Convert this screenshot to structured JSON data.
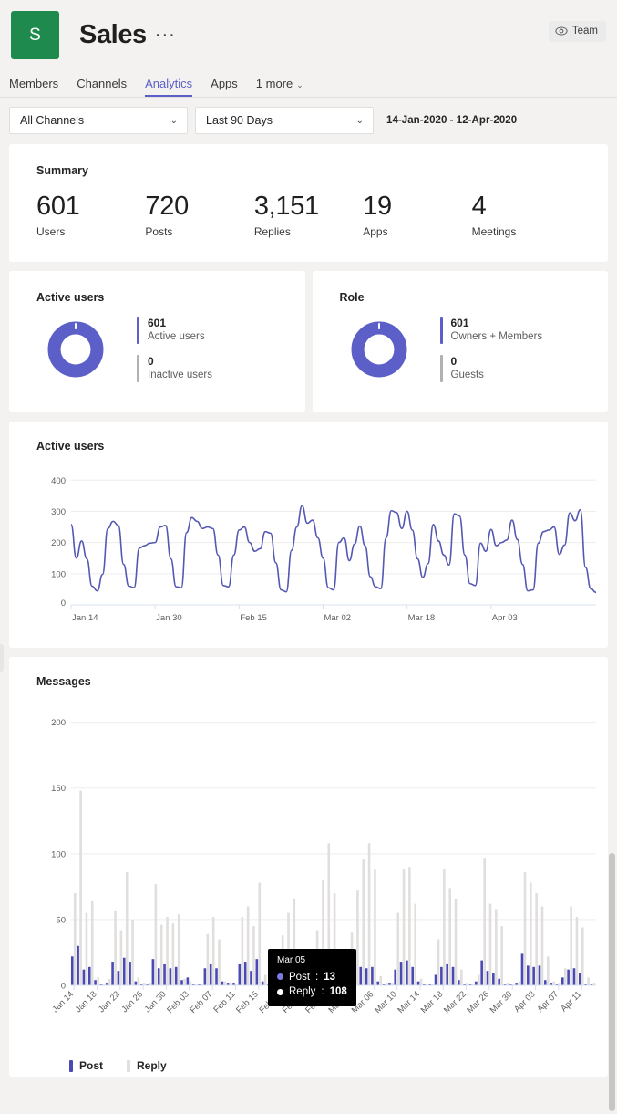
{
  "header": {
    "avatar_initial": "S",
    "team_name": "Sales",
    "more_options": "···",
    "badge_label": "Team",
    "badge_icon": "eye-icon"
  },
  "tabs": [
    {
      "label": "Members",
      "active": false
    },
    {
      "label": "Channels",
      "active": false
    },
    {
      "label": "Analytics",
      "active": true
    },
    {
      "label": "Apps",
      "active": false
    },
    {
      "label": "1 more",
      "active": false,
      "chevron": "⌄"
    }
  ],
  "filters": {
    "channel_filter": {
      "value": "All Channels",
      "chevron": "⌄"
    },
    "date_filter": {
      "value": "Last 90 Days",
      "chevron": "⌄"
    },
    "date_range": "14-Jan-2020 - 12-Apr-2020"
  },
  "summary": {
    "title": "Summary",
    "metrics": [
      {
        "value": "601",
        "label": "Users"
      },
      {
        "value": "720",
        "label": "Posts"
      },
      {
        "value": "3,151",
        "label": "Replies"
      },
      {
        "value": "19",
        "label": "Apps"
      },
      {
        "value": "4",
        "label": "Meetings"
      }
    ]
  },
  "active_users_card": {
    "title": "Active users",
    "legend": [
      {
        "value": "601",
        "label": "Active users",
        "color": "#5b5fc7"
      },
      {
        "value": "0",
        "label": "Inactive users",
        "color": "#b3b0ad"
      }
    ]
  },
  "role_card": {
    "title": "Role",
    "legend": [
      {
        "value": "601",
        "label": "Owners + Members",
        "color": "#5b5fc7"
      },
      {
        "value": "0",
        "label": "Guests",
        "color": "#b3b0ad"
      }
    ]
  },
  "colors": {
    "accent": "#5b5fc7",
    "line": "#5458b3",
    "post_bar": "#4a4ab5",
    "reply_bar": "#e1dfdd",
    "avatar_green": "#1f8a4d",
    "muted": "#b3b0ad"
  },
  "tooltip": {
    "date": "Mar 05",
    "rows": [
      {
        "name": "Post",
        "value": "13",
        "color": "#7c7ce0"
      },
      {
        "name": "Reply",
        "value": "108",
        "color": "#ffffff"
      }
    ]
  },
  "chart_data": [
    {
      "type": "line",
      "title": "Active users",
      "xlabel": "",
      "ylabel": "",
      "ylim": [
        0,
        430
      ],
      "yticks": [
        0,
        100,
        200,
        300,
        400
      ],
      "ytick_labels": [
        "0",
        "100",
        "200",
        "300",
        "400"
      ],
      "xtick_labels": [
        "Jan 14",
        "Jan 30",
        "Feb 15",
        "Mar 02",
        "Mar 18",
        "Apr 03"
      ],
      "xtick_indices": [
        0,
        16,
        32,
        48,
        64,
        80
      ],
      "grid": true,
      "legend_position": "none",
      "series": [
        {
          "name": "Active users",
          "color": "#5458b3",
          "values": [
            258,
            150,
            205,
            148,
            60,
            45,
            98,
            245,
            268,
            255,
            130,
            60,
            55,
            182,
            190,
            198,
            200,
            250,
            255,
            148,
            58,
            55,
            232,
            280,
            268,
            245,
            250,
            245,
            160,
            62,
            58,
            160,
            240,
            250,
            200,
            172,
            180,
            235,
            230,
            135,
            48,
            42,
            175,
            250,
            318,
            262,
            272,
            215,
            150,
            55,
            48,
            200,
            215,
            142,
            195,
            253,
            190,
            90,
            58,
            52,
            215,
            302,
            296,
            245,
            300,
            240,
            148,
            88,
            132,
            258,
            205,
            160,
            128,
            292,
            285,
            160,
            68,
            62,
            198,
            172,
            242,
            190,
            200,
            208,
            272,
            210,
            130,
            45,
            48,
            198,
            235,
            240,
            250,
            162,
            192,
            295,
            270,
            305,
            120,
            52,
            40
          ]
        }
      ]
    },
    {
      "type": "bar",
      "title": "Messages",
      "xlabel": "",
      "ylabel": "",
      "ylim": [
        0,
        215
      ],
      "yticks": [
        0,
        50,
        100,
        150,
        200
      ],
      "ytick_labels": [
        "0",
        "50",
        "100",
        "150",
        "200"
      ],
      "grid": true,
      "legend_position": "bottom-left",
      "stacked": false,
      "categories": [
        "Jan 14",
        "Jan 15",
        "Jan 16",
        "Jan 17",
        "Jan 18",
        "Jan 19",
        "Jan 20",
        "Jan 21",
        "Jan 22",
        "Jan 23",
        "Jan 24",
        "Jan 25",
        "Jan 26",
        "Jan 27",
        "Jan 28",
        "Jan 29",
        "Jan 30",
        "Jan 31",
        "Feb 01",
        "Feb 02",
        "Feb 03",
        "Feb 04",
        "Feb 05",
        "Feb 06",
        "Feb 07",
        "Feb 08",
        "Feb 09",
        "Feb 10",
        "Feb 11",
        "Feb 12",
        "Feb 13",
        "Feb 14",
        "Feb 15",
        "Feb 16",
        "Feb 17",
        "Feb 18",
        "Feb 19",
        "Feb 20",
        "Feb 21",
        "Feb 22",
        "Feb 23",
        "Feb 24",
        "Feb 25",
        "Feb 26",
        "Feb 27",
        "Feb 28",
        "Feb 29",
        "Mar 01",
        "Mar 02",
        "Mar 03",
        "Mar 04",
        "Mar 05",
        "Mar 06",
        "Mar 07",
        "Mar 08",
        "Mar 09",
        "Mar 10",
        "Mar 11",
        "Mar 12",
        "Mar 13",
        "Mar 14",
        "Mar 15",
        "Mar 16",
        "Mar 17",
        "Mar 18",
        "Mar 19",
        "Mar 20",
        "Mar 21",
        "Mar 22",
        "Mar 23",
        "Mar 24",
        "Mar 25",
        "Mar 26",
        "Mar 27",
        "Mar 28",
        "Mar 29",
        "Mar 30",
        "Mar 31",
        "Apr 01",
        "Apr 02",
        "Apr 03",
        "Apr 04",
        "Apr 05",
        "Apr 06",
        "Apr 07",
        "Apr 08",
        "Apr 09",
        "Apr 10",
        "Apr 11",
        "Apr 12"
      ],
      "xtick_labels": [
        "Jan 14",
        "Jan 18",
        "Jan 22",
        "Jan 26",
        "Jan 30",
        "Feb 03",
        "Feb 07",
        "Feb 11",
        "Feb 15",
        "Feb 19",
        "Feb 23",
        "Feb 27",
        "Mar 02",
        "Mar 06",
        "Mar 10",
        "Mar 14",
        "Mar 18",
        "Mar 22",
        "Mar 26",
        "Mar 30",
        "Apr 03",
        "Apr 07",
        "Apr 11"
      ],
      "series": [
        {
          "name": "Post",
          "color": "#4a4ab5",
          "values": [
            22,
            30,
            12,
            14,
            4,
            1,
            2,
            18,
            11,
            21,
            18,
            3,
            1,
            1,
            20,
            13,
            16,
            13,
            14,
            4,
            6,
            1,
            1,
            13,
            16,
            13,
            3,
            2,
            2,
            16,
            18,
            11,
            20,
            3,
            1,
            2,
            13,
            15,
            14,
            5,
            1,
            2,
            9,
            11,
            13,
            7,
            1,
            1,
            10,
            13,
            14,
            13,
            14,
            3,
            1,
            2,
            12,
            18,
            19,
            14,
            3,
            1,
            1,
            8,
            14,
            16,
            14,
            4,
            1,
            1,
            3,
            19,
            11,
            9,
            5,
            1,
            1,
            2,
            24,
            15,
            14,
            15,
            4,
            2,
            1,
            6,
            12,
            13,
            9,
            1,
            1
          ]
        },
        {
          "name": "Reply",
          "color": "#e1dfdd",
          "values": [
            70,
            148,
            55,
            64,
            6,
            1,
            5,
            57,
            42,
            86,
            50,
            6,
            2,
            2,
            77,
            46,
            52,
            47,
            54,
            5,
            3,
            1,
            1,
            39,
            52,
            35,
            3,
            2,
            1,
            52,
            60,
            45,
            78,
            8,
            2,
            1,
            38,
            55,
            66,
            12,
            2,
            1,
            42,
            80,
            108,
            70,
            3,
            2,
            40,
            72,
            96,
            108,
            88,
            7,
            2,
            2,
            55,
            88,
            90,
            62,
            5,
            1,
            1,
            35,
            88,
            74,
            66,
            12,
            2,
            1,
            8,
            97,
            62,
            58,
            45,
            2,
            1,
            3,
            86,
            78,
            70,
            60,
            22,
            3,
            2,
            13,
            60,
            52,
            44,
            6,
            2
          ]
        }
      ]
    }
  ]
}
